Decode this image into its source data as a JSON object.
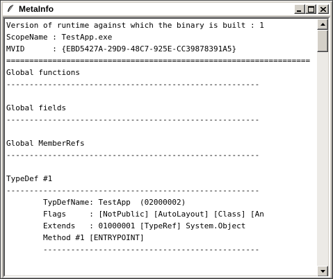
{
  "window": {
    "title": "MetaInfo",
    "icon": "feather-icon",
    "controls": {
      "minimize_icon": "minimize-icon",
      "maximize_icon": "maximize-icon",
      "close_icon": "close-icon"
    }
  },
  "content": {
    "lines": [
      "Version of runtime against which the binary is built : 1",
      "ScopeName : TestApp.exe",
      "MVID      : {EBD5427A-29D9-48C7-925E-CC39878391A5}",
      "==================================================================",
      "Global functions",
      "-------------------------------------------------------",
      "",
      "Global fields",
      "-------------------------------------------------------",
      "",
      "Global MemberRefs",
      "-------------------------------------------------------",
      "",
      "TypeDef #1",
      "-------------------------------------------------------",
      "        TypDefName: TestApp  (02000002)",
      "        Flags     : [NotPublic] [AutoLayout] [Class] [An",
      "        Extends   : 01000001 [TypeRef] System.Object",
      "        Method #1 [ENTRYPOINT]",
      "        -----------------------------------------------",
      ""
    ]
  },
  "scrollbar": {
    "up_icon": "scroll-up-arrow-icon",
    "down_icon": "scroll-down-arrow-icon"
  }
}
